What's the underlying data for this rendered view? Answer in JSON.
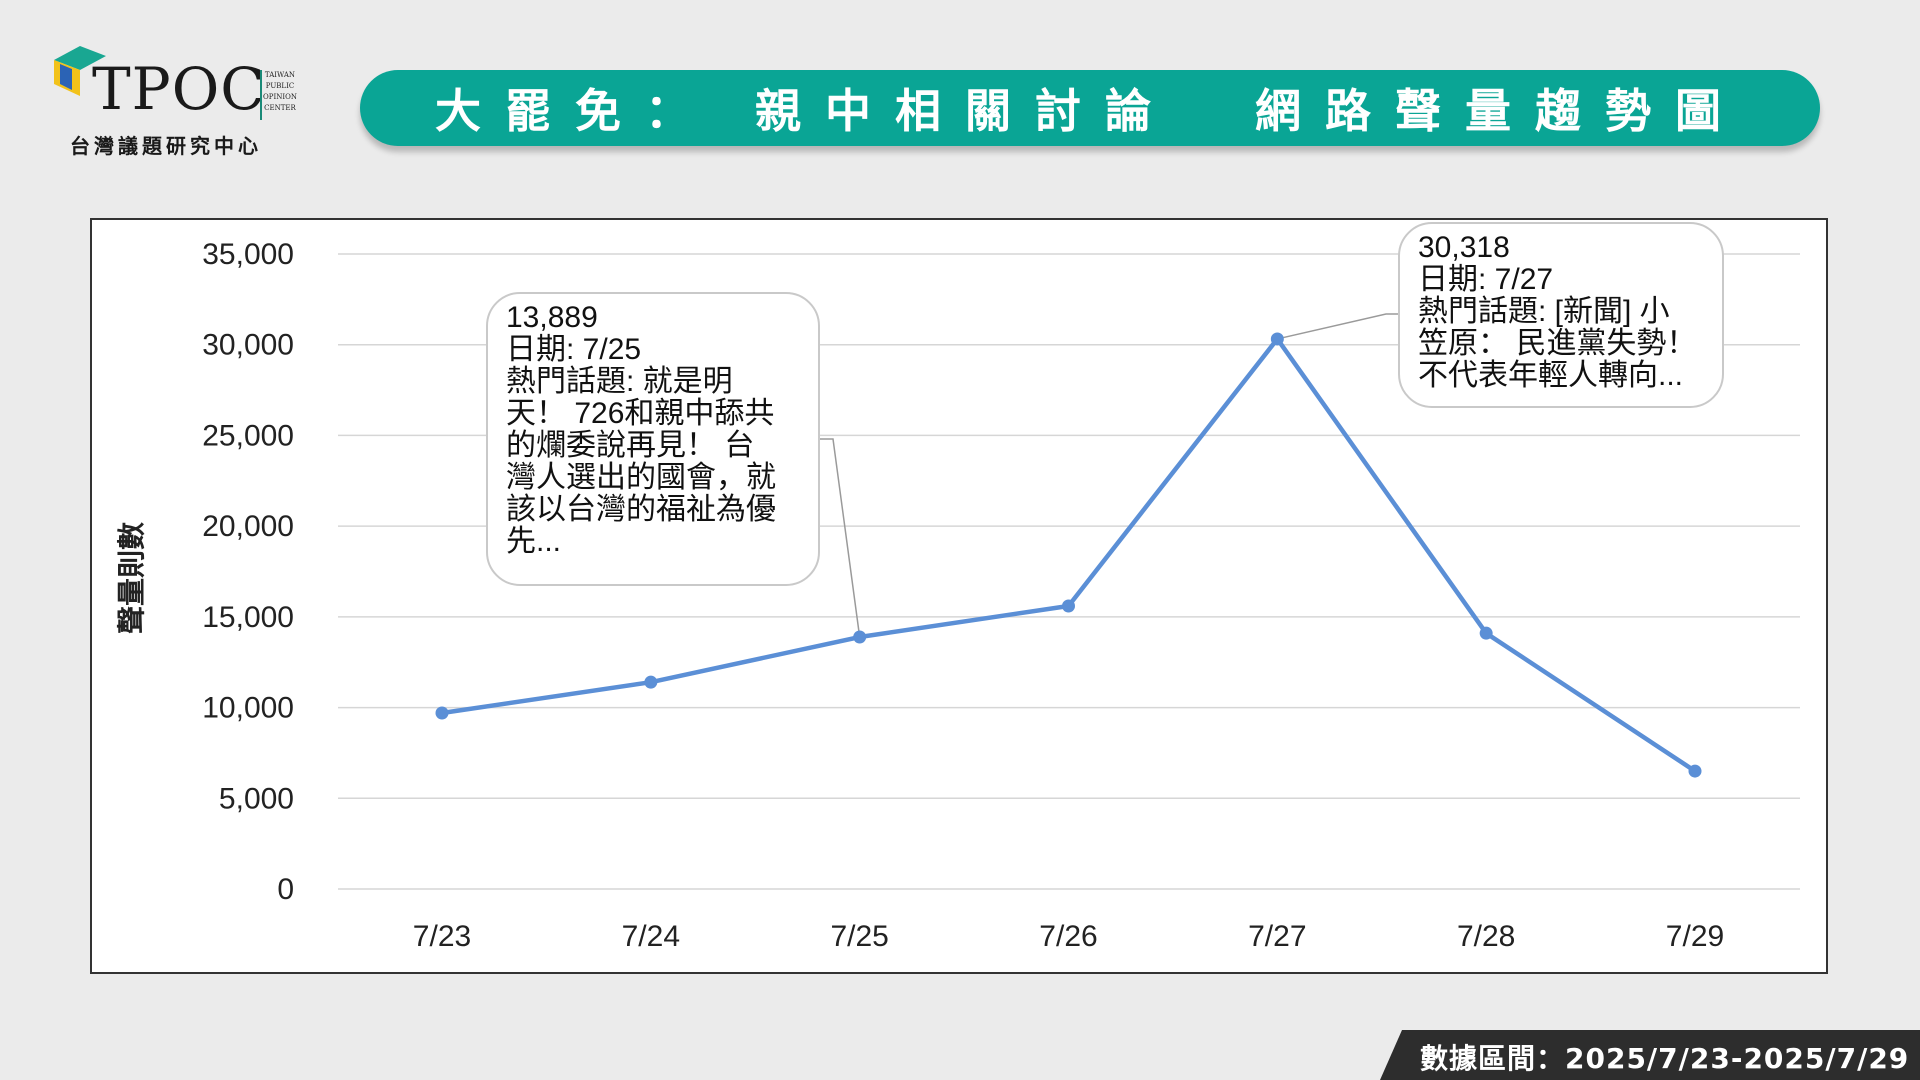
{
  "logo": {
    "name": "TPOC",
    "side_text": [
      "TAIWAN",
      "PUBLIC",
      "OPINION",
      "CENTER"
    ],
    "subtitle": "台灣議題研究中心"
  },
  "title": "大罷免： 親中相關討論  網路聲量趨勢圖",
  "chart_data": {
    "type": "line",
    "categories": [
      "7/23",
      "7/24",
      "7/25",
      "7/26",
      "7/27",
      "7/28",
      "7/29"
    ],
    "series": [
      {
        "values": [
          9700,
          11400,
          13889,
          15600,
          30318,
          14100,
          6500
        ],
        "color": "#5b8fd6"
      }
    ],
    "ylabel": "聲量則數",
    "ylim": [
      0,
      35000
    ],
    "yticks": [
      "0",
      "5,000",
      "10,000",
      "15,000",
      "20,000",
      "25,000",
      "30,000",
      "35,000"
    ],
    "grid": true,
    "annotations": [
      {
        "point_index": 2,
        "lines": [
          "13,889",
          "日期: 7/25",
          "熱門話題: 就是明",
          "天！ 726和親中舔共",
          "的爛委說再見！ 台",
          "灣人選出的國會，就",
          "該以台灣的福祉為優",
          "先..."
        ]
      },
      {
        "point_index": 4,
        "lines": [
          "30,318",
          "日期: 7/27",
          "熱門話題: [新聞] 小",
          "笠原： 民進黨失勢！",
          "不代表年輕人轉向..."
        ]
      }
    ]
  },
  "footer": {
    "text": "數據區間：2025/7/23-2025/7/29"
  },
  "colors": {
    "banner": "#0aa595",
    "line": "#5b8fd6",
    "footer": "#2d2d2d",
    "background": "#ebebeb"
  }
}
